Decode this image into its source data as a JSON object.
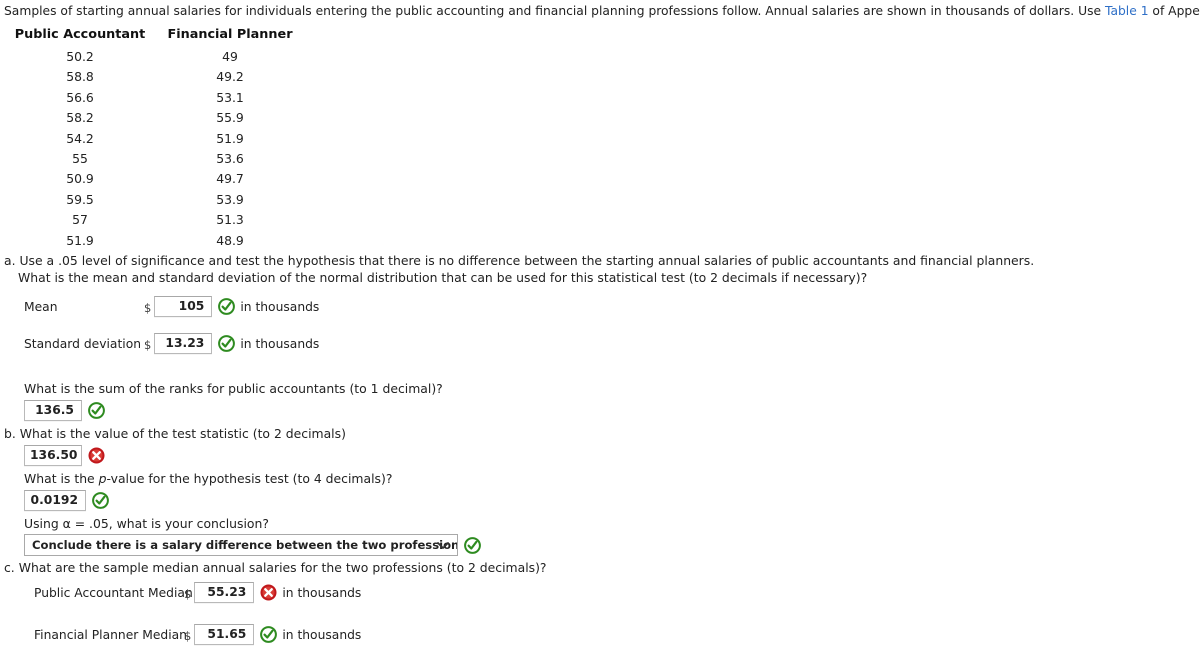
{
  "intro": {
    "text_before_link": "Samples of starting annual salaries for individuals entering the public accounting and financial planning professions follow. Annual salaries are shown in thousands of dollars. Use ",
    "link_label": "Table 1",
    "text_after_link": " of Appendix B.",
    "link_color": "#2e6fc7"
  },
  "table": {
    "headers": [
      "Public Accountant",
      "Financial Planner"
    ],
    "rows": [
      [
        "50.2",
        "49"
      ],
      [
        "58.8",
        "49.2"
      ],
      [
        "56.6",
        "53.1"
      ],
      [
        "58.2",
        "55.9"
      ],
      [
        "54.2",
        "51.9"
      ],
      [
        "55",
        "53.6"
      ],
      [
        "50.9",
        "49.7"
      ],
      [
        "59.5",
        "53.9"
      ],
      [
        "57",
        "51.3"
      ],
      [
        "51.9",
        "48.9"
      ]
    ]
  },
  "questions": {
    "a_line1": "a. Use a .05 level of significance and test the hypothesis that there is no difference between the starting annual salaries of public accountants and financial planners.",
    "a_line2": "What is the mean and standard deviation of the normal distribution that can be used for this statistical test (to 2 decimals if necessary)?",
    "sum_of_ranks": "What is the sum of the ranks for public accountants (to 1 decimal)?",
    "b_test_statistic": "b. What is the value of the test statistic (to 2 decimals)",
    "p_value_prompt_pre": "What is the ",
    "p_value_prompt_italic": "p",
    "p_value_prompt_post": "-value for the hypothesis test (to 4 decimals)?",
    "alpha_prompt": "Using α = .05, what is your conclusion?",
    "c_medians": "c. What are the sample median annual salaries for the two professions (to 2 decimals)?"
  },
  "answers": {
    "mean": {
      "label": "Mean",
      "currency": "$",
      "value": "105",
      "suffix": "in thousands",
      "status": "correct"
    },
    "standard_deviation": {
      "label": "Standard deviation",
      "currency": "$",
      "value": "13.23",
      "suffix": "in thousands",
      "status": "correct"
    },
    "sum_of_ranks": {
      "value": "136.5",
      "status": "correct"
    },
    "test_statistic": {
      "value": "136.50",
      "status": "incorrect"
    },
    "p_value": {
      "value": "0.0192",
      "status": "correct"
    },
    "conclusion": {
      "selected": "Conclude there is a salary difference between the two professions",
      "status": "correct"
    },
    "public_accountant_median": {
      "label": "Public Accountant Median",
      "currency": "$",
      "value": "55.23",
      "suffix": "in thousands",
      "status": "incorrect"
    },
    "financial_planner_median": {
      "label": "Financial Planner Median",
      "currency": "$",
      "value": "51.65",
      "suffix": "in thousands",
      "status": "correct"
    }
  },
  "icons": {
    "correct": "check-circle-icon",
    "incorrect": "x-circle-icon",
    "dropdown": "chevron-down-icon"
  },
  "colors": {
    "correct_green": "#2e8b20",
    "incorrect_red": "#c0181c",
    "text": "#222222",
    "box_border": "#b9b9b9",
    "background": "#ffffff"
  }
}
